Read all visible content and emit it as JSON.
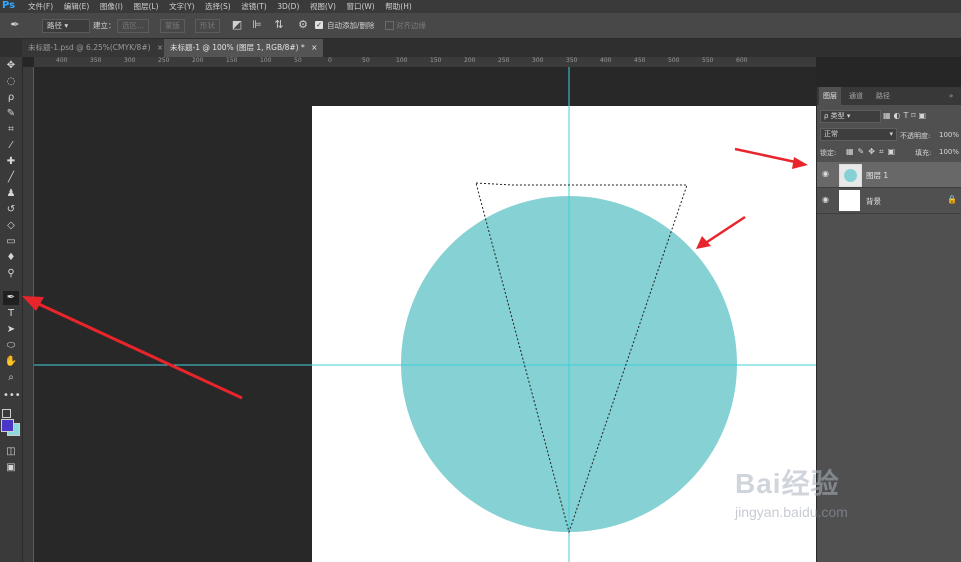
{
  "app": {
    "logo": "Ps"
  },
  "menu": [
    "文件(F)",
    "编辑(E)",
    "图像(I)",
    "图层(L)",
    "文字(Y)",
    "选择(S)",
    "滤镜(T)",
    "3D(D)",
    "视图(V)",
    "窗口(W)",
    "帮助(H)"
  ],
  "options": {
    "mode": "路径",
    "make_label": "建立：",
    "selection_btn": "选区...",
    "mask_btn": "蒙版",
    "shape_btn": "形状",
    "auto_add_delete": "自动添加/删除",
    "align_edges": "对齐边缘"
  },
  "tabs": [
    {
      "label": "未标题-1.psd @ 6.25%(CMYK/8#)",
      "close": "×"
    },
    {
      "label": "未标题-1 @ 100% (图层 1, RGB/8#) *",
      "close": "×"
    }
  ],
  "ruler_labels": [
    "400",
    "350",
    "300",
    "250",
    "200",
    "150",
    "100",
    "50",
    "0",
    "50",
    "100",
    "150",
    "200",
    "250",
    "300",
    "350",
    "400",
    "450",
    "500",
    "550",
    "600"
  ],
  "layers_panel": {
    "tabs": [
      "图层",
      "通道",
      "路径"
    ],
    "collapse": "»",
    "filter_kind": "ρ 类型",
    "blend_mode": "正常",
    "opacity_label": "不透明度:",
    "opacity_value": "100%",
    "lock_label": "锁定:",
    "fill_label": "填充:",
    "fill_value": "100%",
    "layers": [
      {
        "name": "图层 1",
        "selected": true
      },
      {
        "name": "背景",
        "selected": false
      }
    ]
  },
  "colors": {
    "circle": "#85d1d4",
    "guide": "#3fd0da",
    "arrow": "#e8252b",
    "foreground": "#4a36c8",
    "background": "#8fd8dc"
  },
  "watermark": {
    "brand": "Bai经验",
    "url": "jingyan.baidu.com"
  }
}
